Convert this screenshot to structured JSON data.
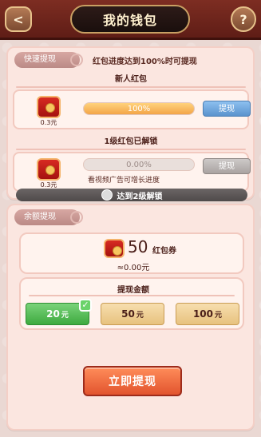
{
  "header": {
    "back_symbol": "<",
    "title": "我的钱包",
    "help_symbol": "?"
  },
  "fast": {
    "tag": "快速提现",
    "hint": "红包进度达到100%时可提现",
    "items": [
      {
        "title": "新人红包",
        "amount": "0.3元",
        "progress_text": "100%",
        "progress_percent": 100,
        "button": "提现",
        "button_state": "enabled"
      },
      {
        "title": "1级红包已解锁",
        "amount": "0.3元",
        "progress_text": "0.00%",
        "progress_percent": 0,
        "button": "提现",
        "button_state": "disabled",
        "hint": "看视频广告可增长进度"
      }
    ],
    "bottom_strip": "达到2级解锁"
  },
  "balance": {
    "tag": "余额提现",
    "voucher_amount": "50",
    "voucher_label": "红包券",
    "approx": "≈0.00元",
    "withdraw_title": "提现金额",
    "amounts": [
      {
        "value": "20",
        "unit": "元",
        "selected": true
      },
      {
        "value": "50",
        "unit": "元",
        "selected": false
      },
      {
        "value": "100",
        "unit": "元",
        "selected": false
      }
    ],
    "checkmark": "✓",
    "cta": "立即提现"
  },
  "icons": {
    "back": "chevron-left-icon",
    "help": "question-mark-icon",
    "redpack": "red-envelope-icon",
    "check": "checkmark-icon"
  }
}
